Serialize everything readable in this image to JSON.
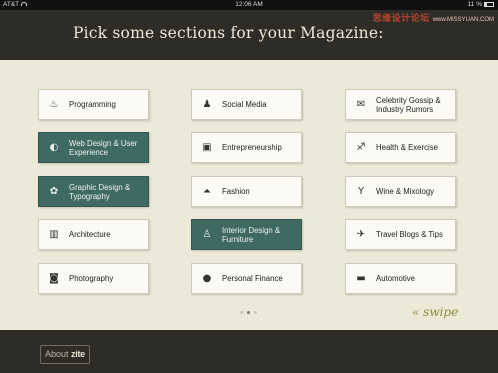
{
  "status_bar": {
    "carrier": "AT&T",
    "time": "12:06 AM",
    "battery": "11 %"
  },
  "watermark": {
    "cn": "思缘设计论坛",
    "en": "www.MISSYUAN.COM"
  },
  "header": {
    "title": "Pick some sections for your Magazine:"
  },
  "sections": [
    {
      "label": "Programming",
      "icon": "coffee-cup-icon",
      "selected": false
    },
    {
      "label": "Social Media",
      "icon": "people-icon",
      "selected": false
    },
    {
      "label": "Celebrity Gossip & Industry Rumors",
      "icon": "speech-bubble-icon",
      "selected": false
    },
    {
      "label": "Web Design & User Experience",
      "icon": "firefox-icon",
      "selected": true
    },
    {
      "label": "Entrepreneurship",
      "icon": "presentation-board-icon",
      "selected": false
    },
    {
      "label": "Health & Exercise",
      "icon": "runner-icon",
      "selected": false
    },
    {
      "label": "Graphic Design & Typography",
      "icon": "palette-icon",
      "selected": true
    },
    {
      "label": "Fashion",
      "icon": "hanger-icon",
      "selected": false
    },
    {
      "label": "Wine & Mixology",
      "icon": "cocktail-glass-icon",
      "selected": false
    },
    {
      "label": "Architecture",
      "icon": "buildings-icon",
      "selected": false
    },
    {
      "label": "Interior Design & Furniture",
      "icon": "chair-icon",
      "selected": true
    },
    {
      "label": "Travel Blogs & Tips",
      "icon": "airplane-icon",
      "selected": false
    },
    {
      "label": "Photography",
      "icon": "camera-icon",
      "selected": false
    },
    {
      "label": "Personal Finance",
      "icon": "piggy-bank-icon",
      "selected": false
    },
    {
      "label": "Automotive",
      "icon": "car-icon",
      "selected": false
    }
  ],
  "pager": {
    "page_count": 3,
    "current_page": 2
  },
  "swipe_hint": "« swipe",
  "footer": {
    "about_prefix": "About",
    "about_brand": "zite"
  },
  "colors": {
    "selected_tile": "#3f6a63",
    "header_bg": "#2d2c26",
    "page_bg": "#ede9d8",
    "swipe_text": "#8e8a3e"
  }
}
